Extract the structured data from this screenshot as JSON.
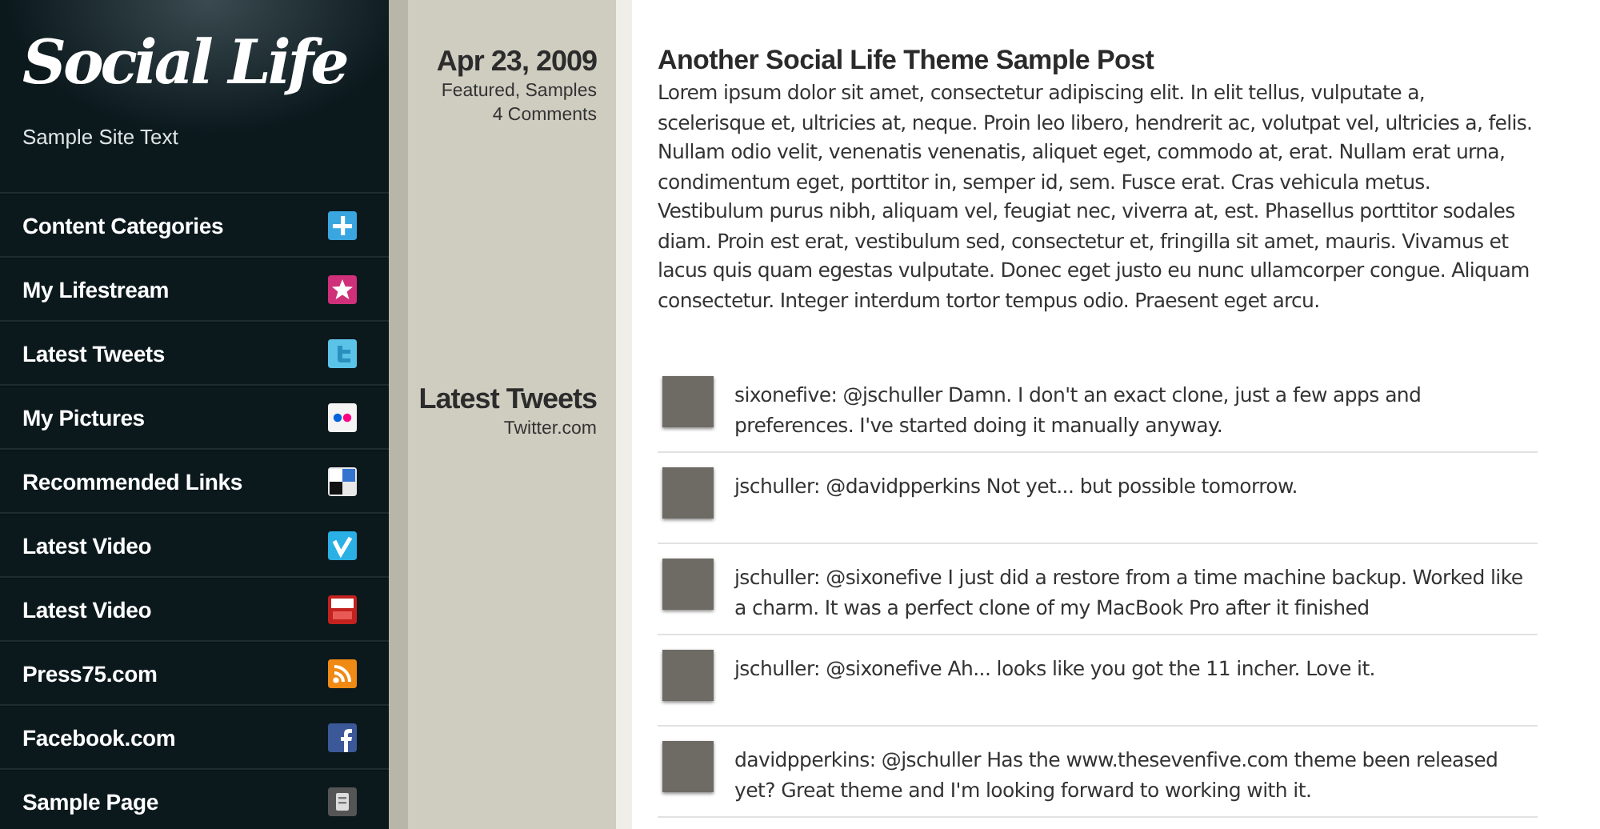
{
  "site": {
    "title": "Social Life",
    "tagline": "Sample Site Text"
  },
  "nav": [
    {
      "label": "Content Categories",
      "kind": "plus"
    },
    {
      "label": "My Lifestream",
      "kind": "star"
    },
    {
      "label": "Latest Tweets",
      "kind": "bird"
    },
    {
      "label": "My Pictures",
      "kind": "dots"
    },
    {
      "label": "Recommended Links",
      "kind": "squares"
    },
    {
      "label": "Latest Video",
      "kind": "vee"
    },
    {
      "label": "Latest Video",
      "kind": "tube"
    },
    {
      "label": "Press75.com",
      "kind": "rss"
    },
    {
      "label": "Facebook.com",
      "kind": "fb"
    },
    {
      "label": "Sample Page",
      "kind": "page"
    }
  ],
  "post": {
    "date": "Apr 23, 2009",
    "categories": "Featured, Samples",
    "comments": "4 Comments",
    "title": "Another Social Life Theme Sample Post",
    "body": "Lorem ipsum dolor sit amet, consectetur adipiscing elit. In elit tellus, vulputate a, scelerisque et, ultricies at, neque. Proin leo libero, hendrerit ac, volutpat vel, ultricies a, felis. Nullam odio velit, venenatis venenatis, aliquet eget, commodo at, erat. Nullam erat urna, condimentum eget, porttitor in, semper id, sem. Fusce erat. Cras vehicula metus. Vestibulum purus nibh, aliquam vel, feugiat nec, viverra at, est. Phasellus porttitor sodales diam. Proin est erat, vestibulum sed, consectetur et, fringilla sit amet, mauris. Vivamus et lacus quis quam egestas vulputate. Donec eget justo eu nunc ullamcorper congue. Aliquam consectetur. Integer interdum tortor tempus odio. Praesent eget arcu."
  },
  "tweets_section": {
    "title": "Latest Tweets",
    "source": "Twitter.com"
  },
  "tweets": [
    {
      "text": "sixonefive: @jschuller Damn. I don't an exact clone, just a few apps and preferences. I've started doing it manually anyway."
    },
    {
      "text": "jschuller: @davidpperkins Not yet... but possible tomorrow."
    },
    {
      "text": "jschuller: @sixonefive I just did a restore from a time machine backup. Worked like a charm. It was a perfect clone of my MacBook Pro after it finished"
    },
    {
      "text": "jschuller: @sixonefive Ah... looks like you got the 11 incher. Love it."
    },
    {
      "text": "davidpperkins: @jschuller Has the www.thesevenfive.com theme been released yet? Great theme and I'm looking forward to working with it."
    }
  ]
}
